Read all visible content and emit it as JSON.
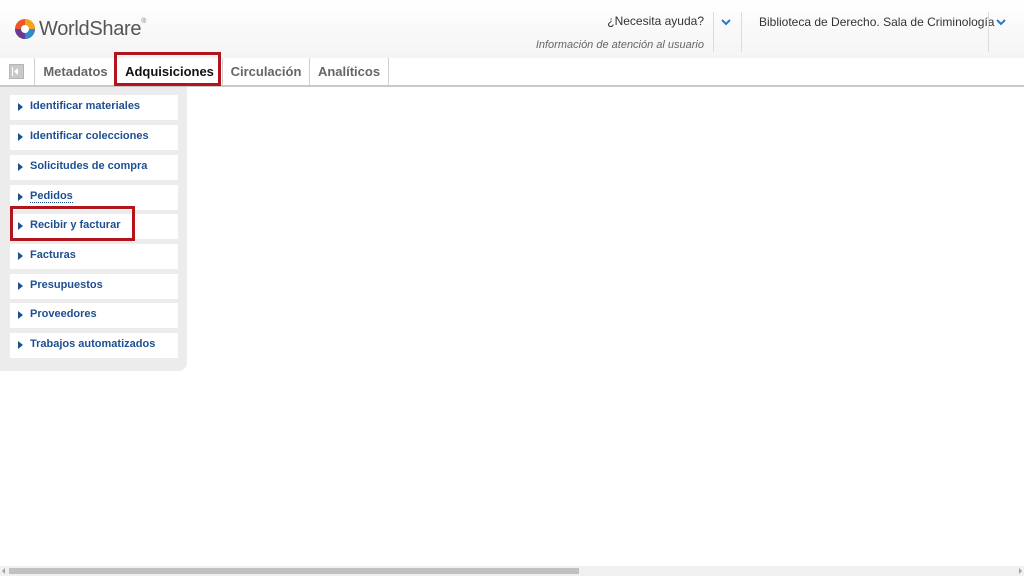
{
  "header": {
    "logo_text": "WorldShare",
    "logo_mark": "®",
    "help_title": "¿Necesita ayuda?",
    "help_subtitle": "Información de atención al usuario",
    "branch": "Biblioteca de Derecho. Sala de Criminología"
  },
  "tabs": [
    {
      "label": "Metadatos",
      "active": false
    },
    {
      "label": "Adquisiciones",
      "active": true
    },
    {
      "label": "Circulación",
      "active": false
    },
    {
      "label": "Analíticos",
      "active": false
    }
  ],
  "sidebar": {
    "items": [
      {
        "label": "Identificar materiales"
      },
      {
        "label": "Identificar colecciones"
      },
      {
        "label": "Solicitudes de compra"
      },
      {
        "label": "Pedidos"
      },
      {
        "label": "Recibir y facturar"
      },
      {
        "label": "Facturas"
      },
      {
        "label": "Presupuestos"
      },
      {
        "label": "Proveedores"
      },
      {
        "label": "Trabajos automatizados"
      }
    ]
  },
  "colors": {
    "accent": "#1d4f91",
    "highlight": "#b3151d",
    "chevron": "#2a7bc0"
  },
  "icons": {
    "logo": "worldshare-logo-icon",
    "help_dropdown": "chevron-down-icon",
    "branch_dropdown": "chevron-down-icon",
    "collapse": "collapse-left-icon",
    "nav_arrow": "triangle-right-icon"
  }
}
